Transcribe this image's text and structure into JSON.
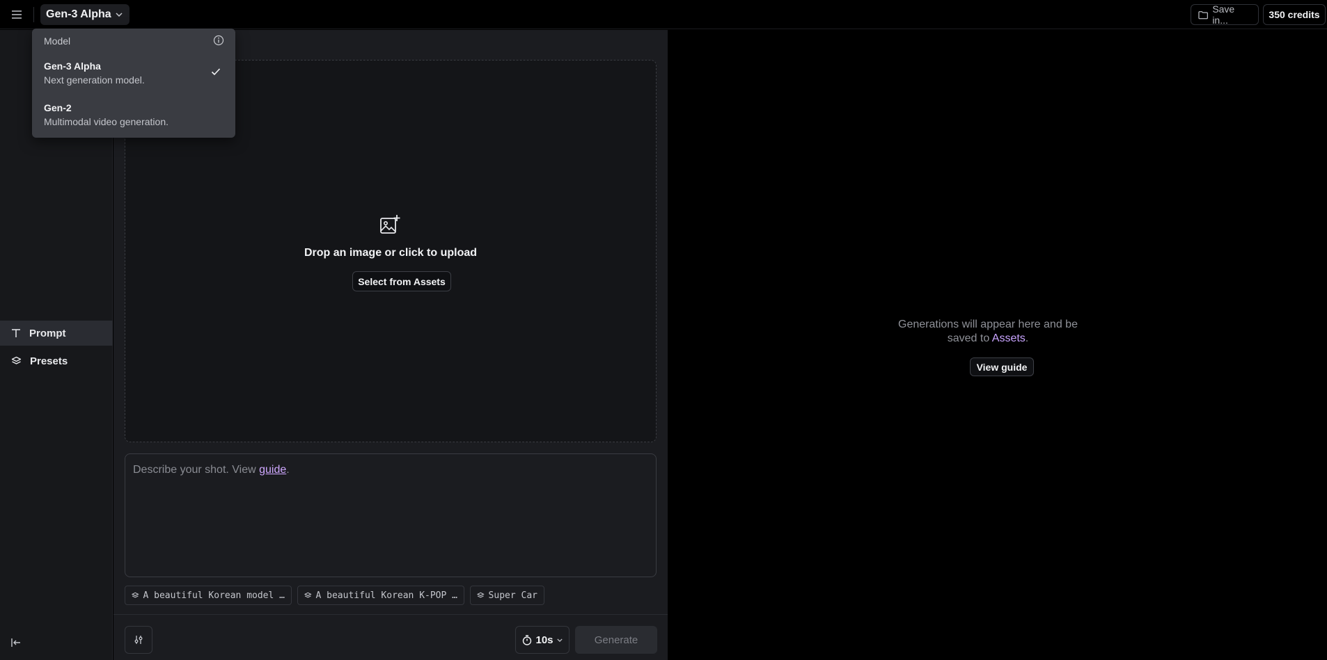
{
  "topbar": {
    "model_label": "Gen-3 Alpha",
    "save_label": "Save in...",
    "credits_label": "350 credits"
  },
  "sidebar": {
    "items": [
      {
        "label": "Prompt",
        "icon": "text-icon",
        "active": true
      },
      {
        "label": "Presets",
        "icon": "layers-icon",
        "active": false
      }
    ]
  },
  "dropdown": {
    "header": "Model",
    "options": [
      {
        "title": "Gen-3 Alpha",
        "desc": "Next generation model.",
        "selected": true
      },
      {
        "title": "Gen-2",
        "desc": "Multimodal video generation.",
        "selected": false
      }
    ]
  },
  "upload": {
    "drop_text": "Drop an image or click to upload",
    "assets_button": "Select from Assets"
  },
  "prompt": {
    "placeholder_prefix": "Describe your shot. View ",
    "placeholder_link": "guide",
    "placeholder_suffix": "."
  },
  "presets_chips": [
    {
      "label": "A beautiful Korean model …"
    },
    {
      "label": "A beautiful Korean K-POP …"
    },
    {
      "label": "Super Car"
    }
  ],
  "bottombar": {
    "duration": "10s",
    "generate_label": "Generate"
  },
  "right_panel": {
    "message_prefix": "Generations will appear here and be saved to ",
    "message_link": "Assets",
    "message_suffix": ".",
    "guide_button": "View guide"
  },
  "colors": {
    "accent": "#c9a4ff",
    "panel": "#1b1c20",
    "sidebar": "#17181b",
    "dropdown": "#3a3c42"
  }
}
